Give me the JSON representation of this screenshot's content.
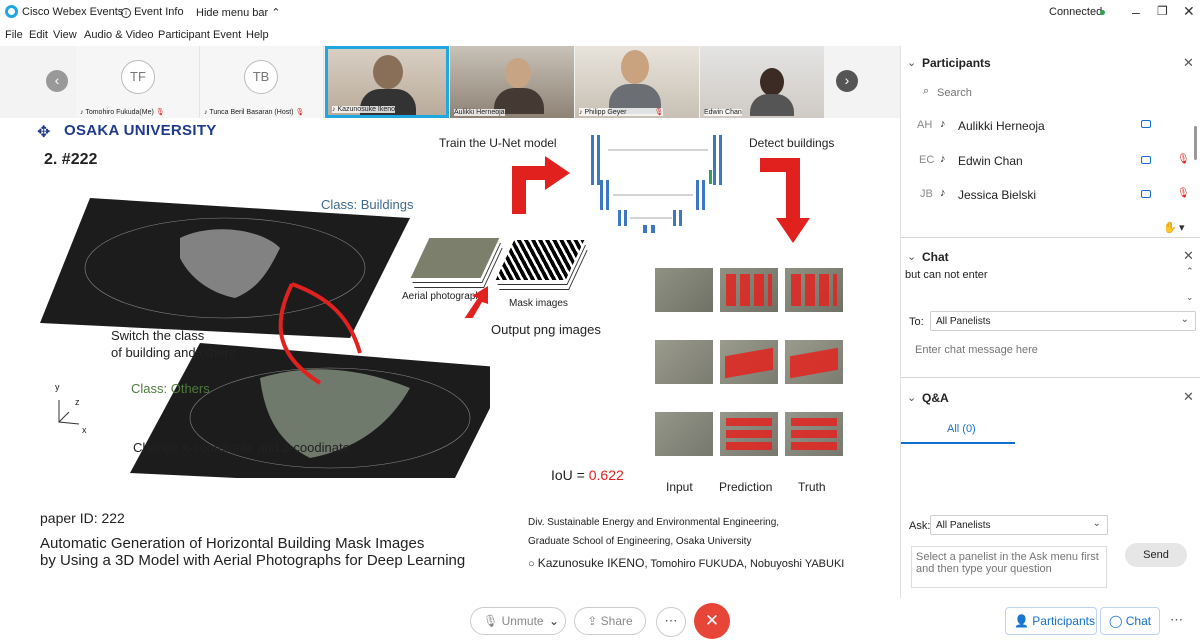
{
  "app": {
    "title": "Cisco Webex Events",
    "event_info": "Event Info",
    "hide_menu": "Hide menu bar",
    "status": "Connected"
  },
  "menu": [
    "File",
    "Edit",
    "View",
    "Audio & Video",
    "Participant",
    "Event",
    "Help"
  ],
  "participants_strip": {
    "tiles": [
      {
        "initials": "TF",
        "name": "Tomohiro Fukuda(Me)"
      },
      {
        "initials": "TB",
        "name": "Tunca Beril Basaran (Host)"
      }
    ],
    "videos": [
      {
        "name": "Kazunosuke Ikeno"
      },
      {
        "name": "Aulikki Herneoja"
      },
      {
        "name": "Philipp Geyer"
      },
      {
        "name": "Edwin Chan"
      }
    ]
  },
  "slide": {
    "university": "OSAKA UNIVERSITY",
    "number": "2. #222",
    "train_label": "Train the U-Net model",
    "detect_label": "Detect buildings",
    "class_buildings": "Class: Buildings",
    "class_others": "Class: Others",
    "switch_line1": "Switch the class",
    "switch_line2": "of building and others",
    "change_coord": "Change x-coordinate and z-coodinate",
    "aerial": "Aerial photographs",
    "mask": "Mask images",
    "output": "Output png images",
    "iou_prefix": "IoU = ",
    "iou_value": "0.622",
    "col_input": "Input",
    "col_prediction": "Prediction",
    "col_truth": "Truth",
    "axis_y": "y",
    "axis_z": "z",
    "axis_x": "x",
    "paper_id": "paper ID: 222",
    "paper_title_1": "Automatic Generation of Horizontal Building Mask Images",
    "paper_title_2": "by Using a 3D Model with Aerial Photographs for Deep Learning",
    "affil_1": "Div. Sustainable Energy and Environmental Engineering,",
    "affil_2": "Graduate School of Engineering, Osaka University",
    "authors_main": "Kazunosuke IKENO",
    "authors_rest": ", Tomohiro FUKUDA, Nobuyoshi YABUKI"
  },
  "panel": {
    "participants_header": "Participants",
    "search_placeholder": "Search",
    "people": [
      {
        "initials": "AH",
        "name": "Aulikki Herneoja"
      },
      {
        "initials": "EC",
        "name": "Edwin Chan"
      },
      {
        "initials": "JB",
        "name": "Jessica Bielski"
      }
    ],
    "chat_header": "Chat",
    "chat_message": "but can not enter",
    "to_label": "To:",
    "to_value": "All Panelists",
    "chat_placeholder": "Enter chat message here",
    "qa_header": "Q&A",
    "qa_tab": "All (0)",
    "ask_label": "Ask:",
    "ask_value": "All Panelists",
    "ask_placeholder": "Select a panelist in the Ask menu first and then type your question",
    "send": "Send"
  },
  "bottom": {
    "unmute": "Unmute",
    "share": "Share",
    "participants": "Participants",
    "chat": "Chat"
  },
  "colors": {
    "accent": "#1170cf",
    "red": "#e0211e",
    "end": "#e64538",
    "green": "#2da44e"
  }
}
